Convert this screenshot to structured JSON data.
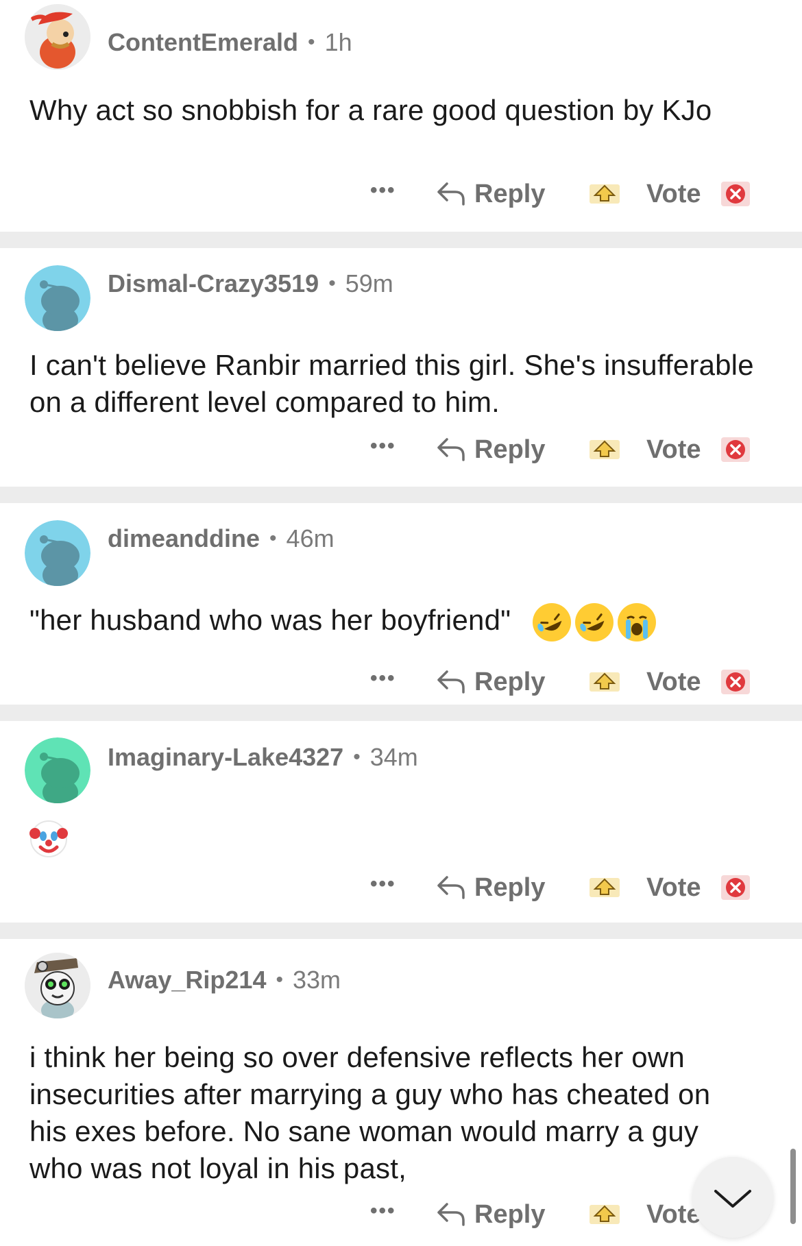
{
  "comments": [
    {
      "username": "ContentEmerald",
      "time": "1h",
      "text": "Why act so snobbish for a rare good question by KJo",
      "avatar": "snoo-red-hair-avatar",
      "emojis": []
    },
    {
      "username": "Dismal-Crazy3519",
      "time": "59m",
      "text": "I can't believe Ranbir married this girl. She's insufferable on a different level compared to him.",
      "avatar": "snoo-default-blue-avatar",
      "emojis": []
    },
    {
      "username": "dimeanddine",
      "time": "46m",
      "text": "\"her husband who was her boyfriend\"",
      "avatar": "snoo-default-blue-avatar",
      "emojis": [
        "rolling-on-floor-laughing-emoji",
        "rolling-on-floor-laughing-emoji",
        "loudly-crying-emoji"
      ]
    },
    {
      "username": "Imaginary-Lake4327",
      "time": "34m",
      "text": "",
      "avatar": "snoo-default-green-avatar",
      "emojis": [
        "clown-face-emoji"
      ]
    },
    {
      "username": "Away_Rip214",
      "time": "33m",
      "text": "i think her being so over defensive reflects her own insecurities after marrying a guy who has cheated on his exes before. No sane woman would marry a guy who was not loyal in his past,",
      "avatar": "snoo-hat-goggles-avatar",
      "emojis": []
    }
  ],
  "actions": {
    "more": "•••",
    "reply": "Reply",
    "vote": "Vote"
  },
  "icons": {
    "reply": "reply-arrow-icon",
    "upvote": "upvote-award-icon",
    "downvote": "downvote-x-icon",
    "scroll": "chevron-down-icon"
  },
  "colors": {
    "username": "#6f6f6f",
    "separator": "#ececec",
    "upvote_gold": "#f2c94c",
    "downvote_red": "#e0393e",
    "blue_avatar": "#7fd3ea",
    "green_avatar": "#5fe3b5"
  }
}
